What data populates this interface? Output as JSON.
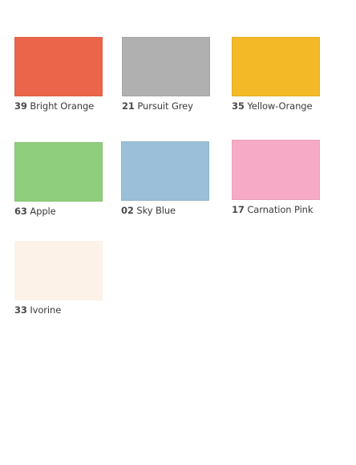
{
  "swatches": [
    {
      "code": "39",
      "name": "Bright Orange",
      "color": "#ea6549"
    },
    {
      "code": "21",
      "name": "Pursuit Grey",
      "color": "#b1b0b1"
    },
    {
      "code": "35",
      "name": "Yellow-Orange",
      "color": "#f4b927"
    },
    {
      "code": "63",
      "name": "Apple",
      "color": "#8fce7c"
    },
    {
      "code": "02",
      "name": "Sky Blue",
      "color": "#9bbfd8"
    },
    {
      "code": "17",
      "name": "Carnation Pink",
      "color": "#f7aac6"
    },
    {
      "code": "33",
      "name": "Ivorine",
      "color": "#fdf2e8"
    }
  ]
}
